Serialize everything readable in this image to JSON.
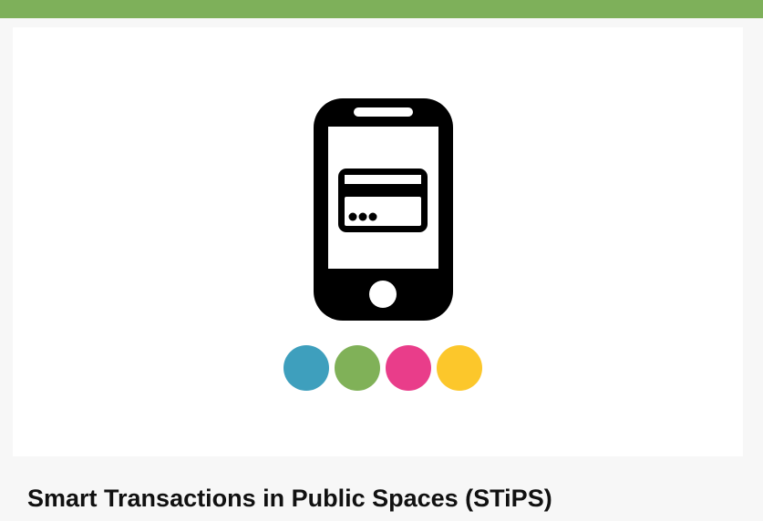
{
  "page": {
    "title": "Smart Transactions in Public Spaces (STiPS)"
  },
  "colors": {
    "top_bar": "#7eb05a",
    "dot_blue": "#3e9fbd",
    "dot_green": "#80b158",
    "dot_pink": "#e93d8a",
    "dot_yellow": "#fcc72b",
    "phone": "#000000"
  },
  "illustration": {
    "icons": [
      "mobile-phone-icon",
      "credit-card-icon",
      "home-button-icon"
    ]
  }
}
